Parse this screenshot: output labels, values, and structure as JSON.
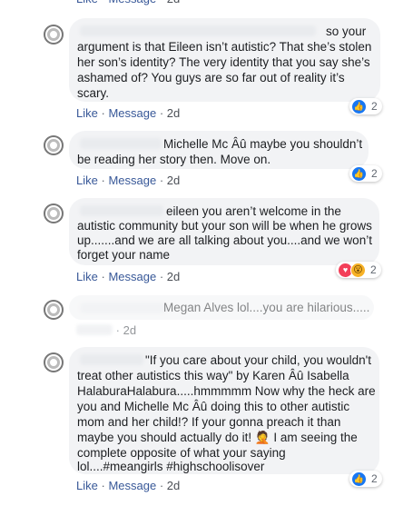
{
  "actions": {
    "like": "Like",
    "message": "Message",
    "separator": "·"
  },
  "comments": [
    {
      "lines": [
        "so your",
        "argument is that Eileen isn’t autistic? That she’s stolen",
        "her son’s identity? The very identity that you say she’s",
        "ashamed of? You guys are so far out of reality it’s",
        "scary."
      ],
      "time": "2d",
      "reactions": {
        "icons": [
          "like-icon"
        ],
        "count": "2"
      }
    },
    {
      "lines": [
        "Michelle Mc Âû maybe you shouldn’t",
        "be reading her story then. Move on."
      ],
      "time": "2d",
      "reactions": {
        "icons": [
          "like-icon"
        ],
        "count": "2"
      }
    },
    {
      "lines": [
        "eileen you aren’t welcome in the",
        "autistic community but your son will be when he grows",
        "up.......and we are all talking about you....and we won’t",
        "forget your name"
      ],
      "time": "2d",
      "reactions": {
        "icons": [
          "love-icon",
          "wow-icon"
        ],
        "count": "2"
      }
    },
    {
      "lines": [
        "Megan Alves lol....you are hilarious....."
      ],
      "time": "2d"
    },
    {
      "lines": [
        "\"If you care about your child, you wouldn't",
        "treat other autistics this way\" by Karen Âû Isabella",
        "HalaburaHalabura.....hmmmmm Now why the heck are",
        "you and Michelle Mc Âû doing this to other autistic",
        "mom and her child!? If your gonna preach it than",
        "maybe you should actually do it! 🤦 I am seeing the",
        "complete opposite of what your saying",
        "lol....#meangirls #highschoolisover"
      ],
      "time": "2d",
      "reactions": {
        "icons": [
          "like-icon"
        ],
        "count": "2"
      }
    }
  ],
  "top_action_row": {
    "time": "2d"
  }
}
